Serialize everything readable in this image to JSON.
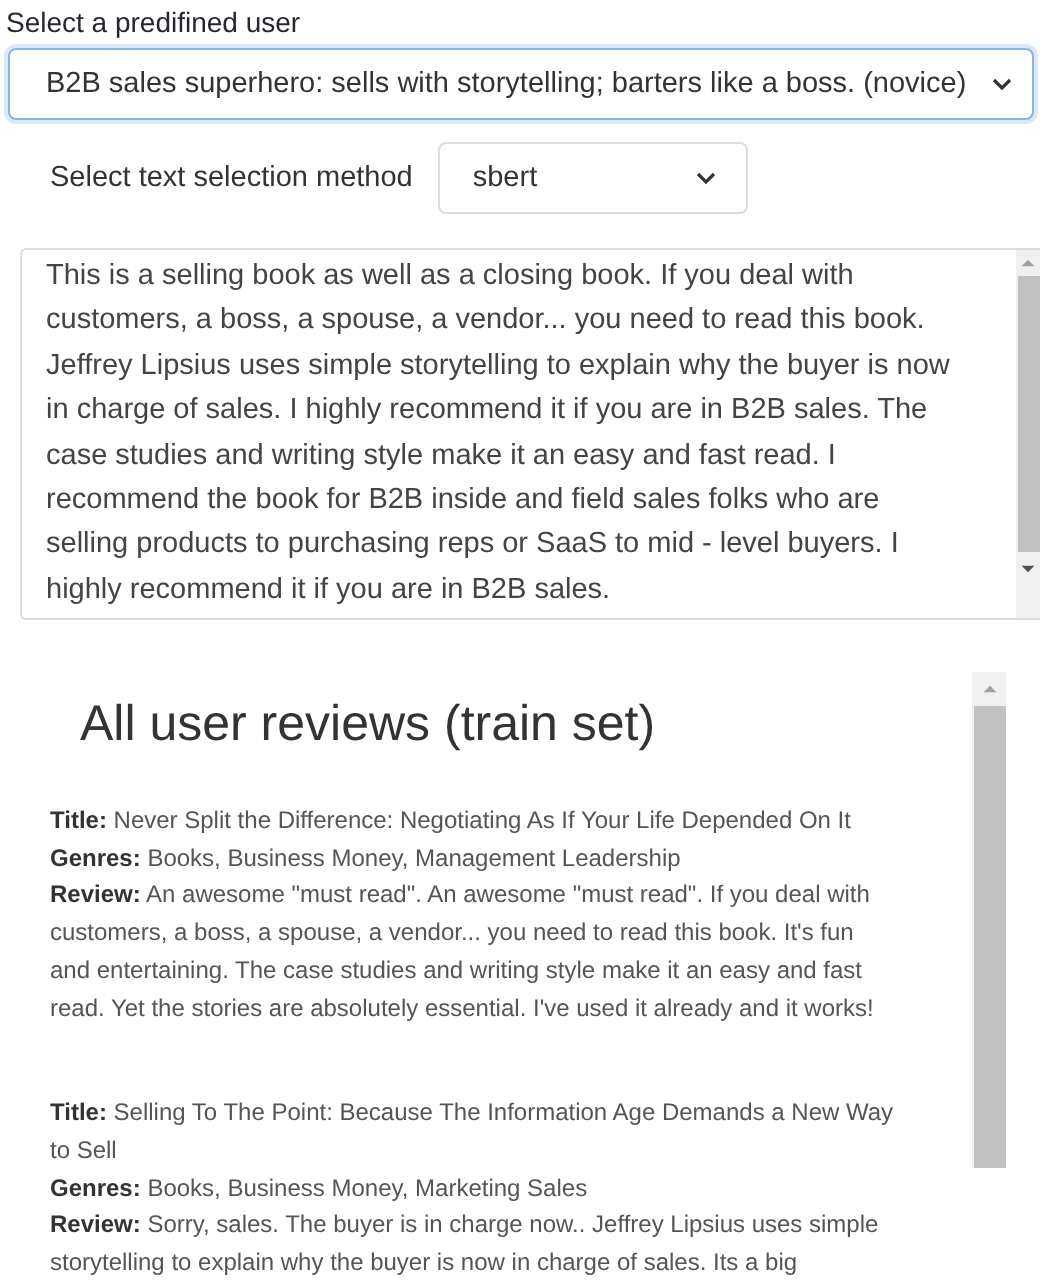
{
  "user_select": {
    "label": "Select a predifined user",
    "value": "B2B sales superhero: sells with storytelling; barters like a boss. (novice)",
    "focused": true
  },
  "method_select": {
    "label": "Select text selection method",
    "value": "sbert"
  },
  "user_text": "This is a selling book as well as a closing book. If you deal with customers, a boss, a spouse, a vendor... you need to read this book. Jeffrey Lipsius uses simple storytelling to explain why the buyer is now in charge of sales. I highly recommend it if you are in B2B sales. The case studies and writing style make it an easy and fast read. I recommend the book for B2B inside and field sales folks who are selling products to purchasing reps or SaaS to mid - level buyers. I highly recommend it if you are in B2B sales.",
  "reviews_heading": "All user reviews (train set)",
  "reviews": [
    {
      "lines": [
        "**Title:** Never Split the Difference: Negotiating As If Your Life Depended On It",
        "**Genres:** Books, Business Money, Management Leadership",
        "**Review:** An awesome \"must read\". An awesome \"must read\". If you deal with customers, a boss, a spouse, a vendor... you need to read this book. It's fun and entertaining. The case studies and writing style make it an easy and fast read. Yet the stories are absolutely essential. I've used it already and it works!"
      ]
    },
    {
      "lines": [
        "**Title:** Selling To The Point: Because The Information Age Demands a New Way to Sell",
        "**Genres:** Books, Business Money, Marketing Sales",
        "**Review:** Sorry, sales. The buyer is in charge now.. Jeffrey Lipsius uses simple storytelling to explain why the buyer is now in charge of sales. Its a big"
      ]
    }
  ]
}
